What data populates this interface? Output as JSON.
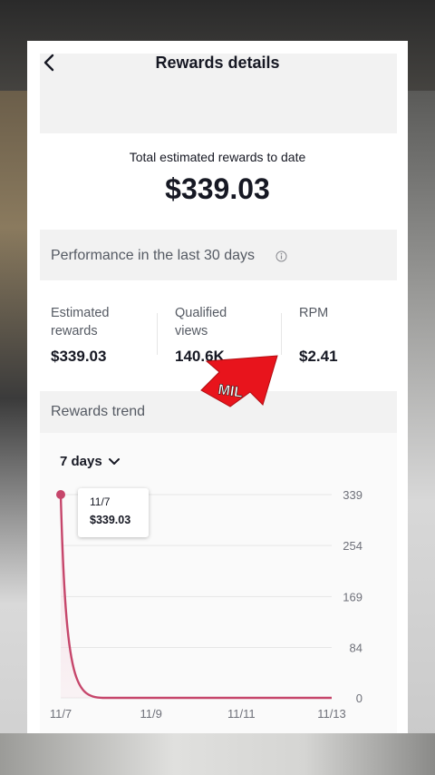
{
  "header": {
    "title": "Rewards details"
  },
  "total": {
    "label": "Total estimated rewards to date",
    "value": "$339.03"
  },
  "performance": {
    "label": "Performance in the last 30 days",
    "metrics": [
      {
        "label": "Estimated rewards",
        "value": "$339.03"
      },
      {
        "label": "Qualified views",
        "value": "140.6K"
      },
      {
        "label": "RPM",
        "value": "$2.41"
      }
    ]
  },
  "trend": {
    "label": "Rewards trend",
    "range_selector": "7 days",
    "tooltip": {
      "date": "11/7",
      "value": "$339.03"
    }
  },
  "overlay": {
    "arrow_text": "MIL",
    "arrow_color": "#e8141c"
  },
  "colors": {
    "series": "#c6466b",
    "fill": "#f6dbe3",
    "grid": "#e6e6e6"
  },
  "chart_data": {
    "type": "area",
    "x": [
      "11/7",
      "11/8",
      "11/9",
      "11/10",
      "11/11",
      "11/12",
      "11/13"
    ],
    "x_tick_labels": [
      "11/7",
      "11/9",
      "11/11",
      "11/13"
    ],
    "y_tick_labels": [
      "339",
      "254",
      "169",
      "84",
      "0"
    ],
    "series": [
      {
        "values": [
          339.03,
          0,
          0,
          0,
          0,
          0,
          0
        ]
      }
    ],
    "ylim": [
      0,
      339
    ],
    "grid": true
  }
}
